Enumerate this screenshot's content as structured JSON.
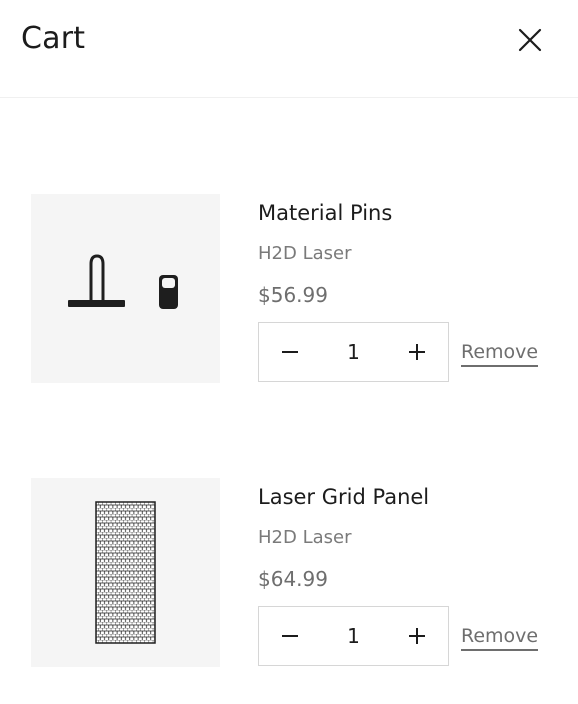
{
  "header": {
    "title": "Cart",
    "close_icon": "close-icon"
  },
  "items": [
    {
      "name": "Material Pins",
      "variant": "H2D Laser",
      "price": "$56.99",
      "quantity": "1",
      "remove_label": "Remove",
      "image": "material-pins-image"
    },
    {
      "name": "Laser Grid Panel",
      "variant": "H2D Laser",
      "price": "$64.99",
      "quantity": "1",
      "remove_label": "Remove",
      "image": "laser-grid-panel-image"
    }
  ],
  "icons": {
    "minus": "minus-icon",
    "plus": "plus-icon"
  },
  "colors": {
    "text": "#1c1c1c",
    "muted": "#7a7a7a",
    "image_bg": "#f5f5f5",
    "border": "#d6d6d6"
  }
}
